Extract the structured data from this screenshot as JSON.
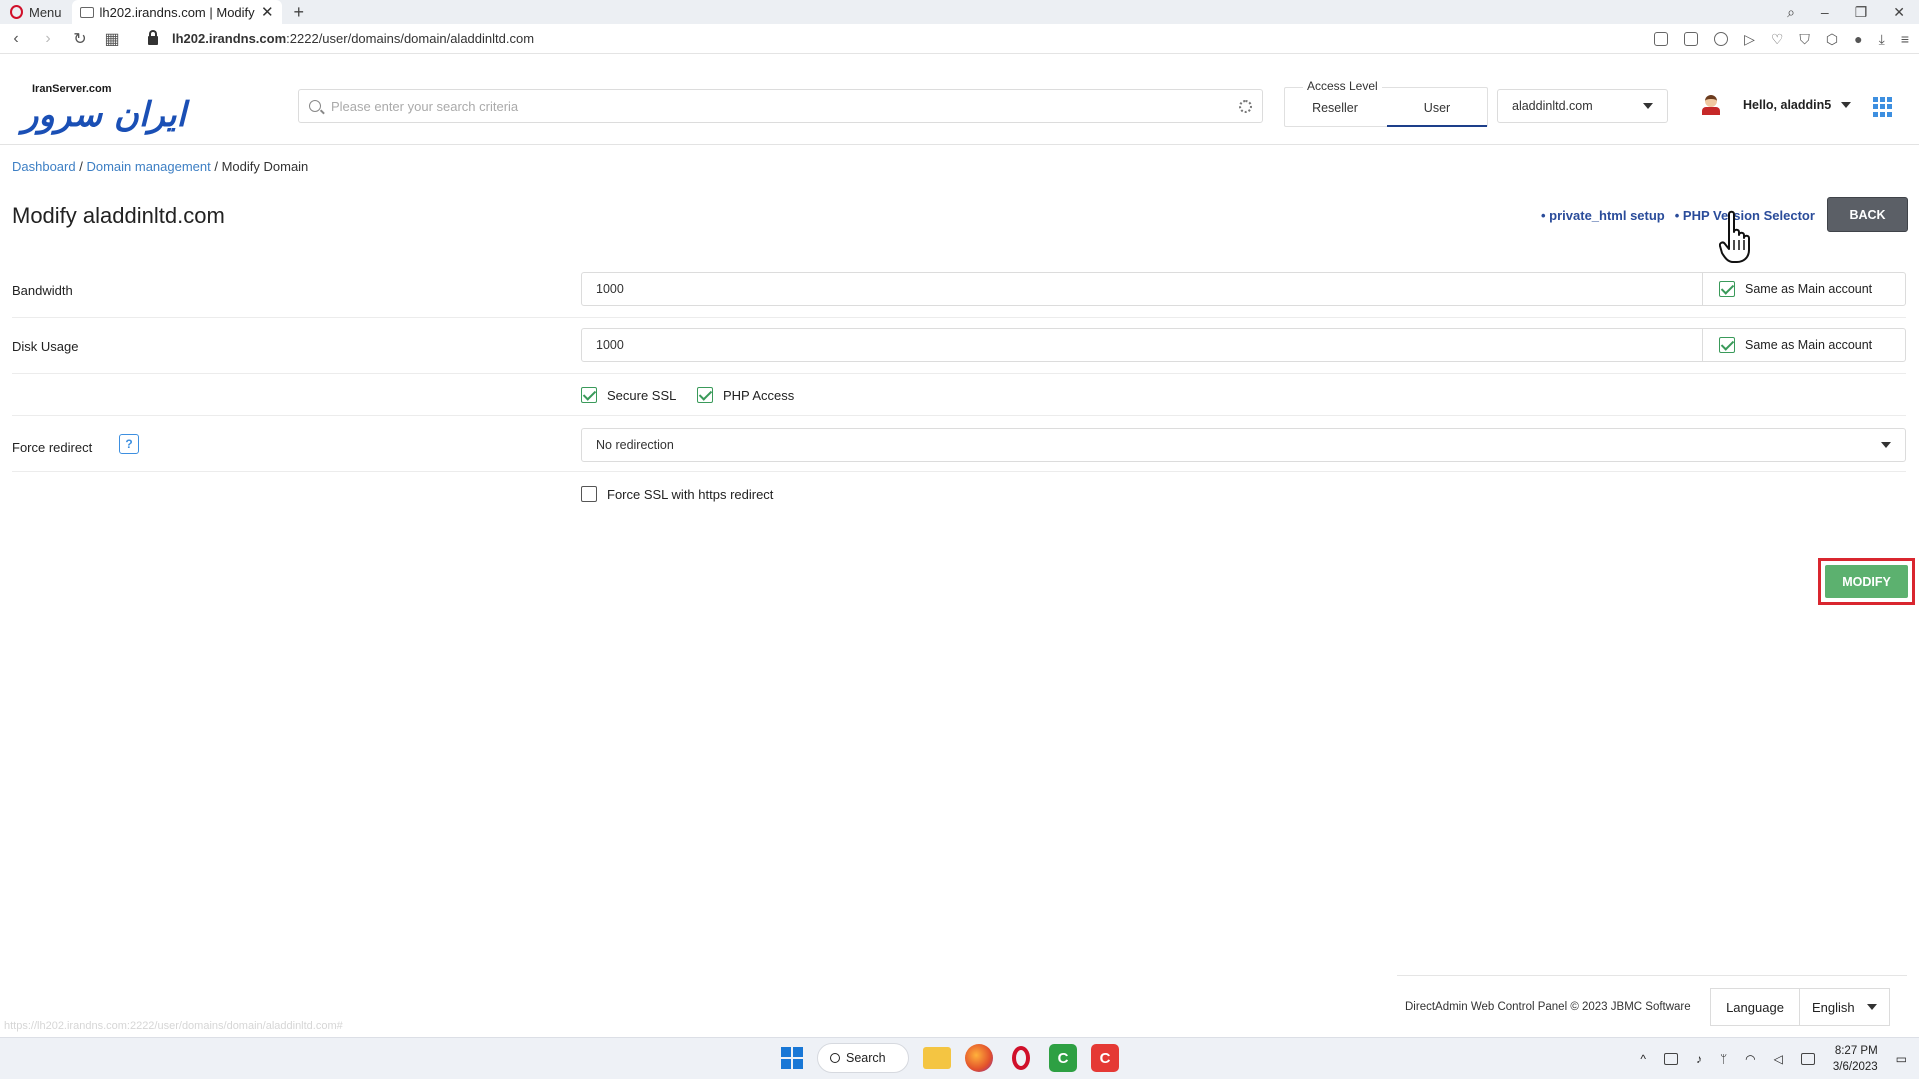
{
  "browser": {
    "menu_label": "Menu",
    "tab_title": "lh202.irandns.com | Modify",
    "url_host": "lh202.irandns.com",
    "url_rest": ":2222/user/domains/domain/aladdinltd.com",
    "status_url": "https://lh202.irandns.com:2222/user/domains/domain/aladdinltd.com#"
  },
  "header": {
    "logo_small": "IranServer.com",
    "logo_big": "ایران سرور",
    "search_placeholder": "Please enter your search criteria",
    "access_level": {
      "legend": "Access Level",
      "options": [
        "Reseller",
        "User"
      ],
      "selected": "User"
    },
    "domain_select": "aladdinltd.com",
    "greeting": "Hello, aladdin5"
  },
  "breadcrumb": {
    "dashboard": "Dashboard",
    "domain_management": "Domain management",
    "current": "Modify Domain",
    "sep": " / "
  },
  "page": {
    "title": "Modify aladdinltd.com",
    "link_private_html": "• private_html setup",
    "link_php_selector": "• PHP Version Selector",
    "back_label": "BACK"
  },
  "form": {
    "bandwidth": {
      "label": "Bandwidth",
      "value": "1000",
      "same_as_main": "Same as Main account",
      "same_checked": true
    },
    "disk_usage": {
      "label": "Disk Usage",
      "value": "1000",
      "same_as_main": "Same as Main account",
      "same_checked": true
    },
    "secure_ssl": {
      "label": "Secure SSL",
      "checked": true
    },
    "php_access": {
      "label": "PHP Access",
      "checked": true
    },
    "force_redirect": {
      "label": "Force redirect",
      "help": "?",
      "value": "No redirection"
    },
    "force_ssl": {
      "label": "Force SSL with https redirect",
      "checked": false
    },
    "modify_label": "MODIFY"
  },
  "footer": {
    "copyright": "DirectAdmin Web Control Panel © 2023 JBMC Software",
    "language_label": "Language",
    "language_value": "English"
  },
  "taskbar": {
    "search_label": "Search",
    "time": "8:27 PM",
    "date": "3/6/2023"
  },
  "colors": {
    "accent_blue": "#2a4c9a",
    "link_blue": "#3d7fc4",
    "modify_green": "#5cb16f",
    "highlight_red": "#d9262f",
    "back_gray": "#5b5f66"
  }
}
